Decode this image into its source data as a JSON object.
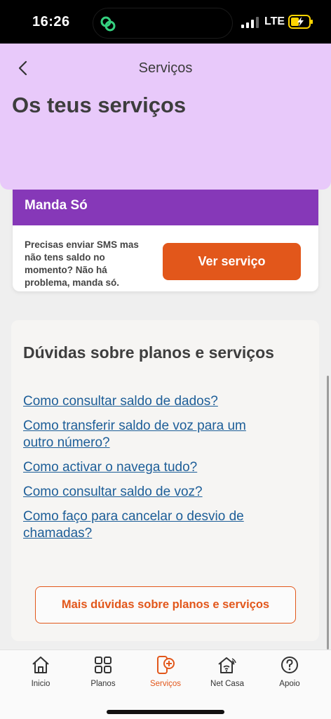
{
  "status_bar": {
    "time": "16:26",
    "network": "LTE"
  },
  "header": {
    "title": "Serviços",
    "page_title": "Os teus serviços"
  },
  "service": {
    "name": "Manda Só",
    "description": "Precisas enviar SMS mas não tens saldo no momento? Não há problema, manda só.",
    "button_label": "Ver serviço"
  },
  "faq": {
    "title": "Dúvidas sobre planos e serviços",
    "links": [
      "Como consultar saldo de dados?",
      "Como transferir saldo de voz para um outro  número?",
      "Como activar o navega tudo?",
      "Como consultar saldo de voz?",
      "Como faço para cancelar  o desvio de chamadas?"
    ],
    "more_button": "Mais dúvidas sobre planos e serviços"
  },
  "nav": {
    "items": [
      {
        "label": "Inicio",
        "icon": "home-icon"
      },
      {
        "label": "Planos",
        "icon": "grid-icon"
      },
      {
        "label": "Serviços",
        "icon": "services-icon"
      },
      {
        "label": "Net Casa",
        "icon": "wifi-home-icon"
      },
      {
        "label": "Apoio",
        "icon": "help-icon"
      }
    ],
    "active_index": 2
  },
  "colors": {
    "accent": "#e2571b",
    "header_bg": "#e8c9fa",
    "service_header": "#8638b8",
    "link": "#1d5e98"
  }
}
